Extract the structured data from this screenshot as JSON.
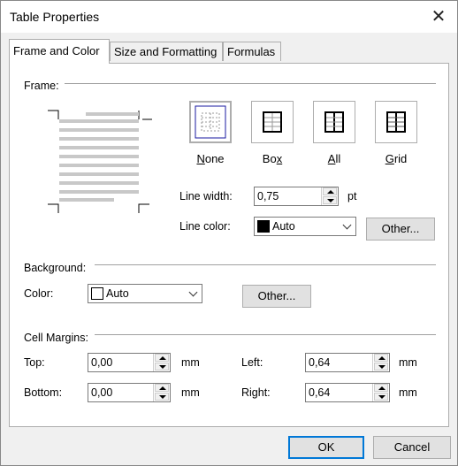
{
  "window": {
    "title": "Table Properties"
  },
  "tabs": [
    "Frame and Color",
    "Size and Formatting",
    "Formulas"
  ],
  "frame": {
    "group_label": "Frame:",
    "options": [
      {
        "label_pre": "",
        "mnemonic": "N",
        "label_post": "one"
      },
      {
        "label_pre": "Bo",
        "mnemonic": "x",
        "label_post": ""
      },
      {
        "label_pre": "",
        "mnemonic": "A",
        "label_post": "ll"
      },
      {
        "label_pre": "",
        "mnemonic": "G",
        "label_post": "rid"
      }
    ],
    "line_width_label": "Line width:",
    "line_width_mnemonic_index": 5,
    "line_width_value": "0,75",
    "line_width_unit": "pt",
    "line_color_label": "Line color:",
    "line_color_value": "Auto",
    "line_color_swatch": "#000000",
    "other_button": "Other..."
  },
  "background": {
    "group_label": "Background:",
    "color_label": "Color:",
    "color_value": "Auto",
    "color_swatch": "#ffffff",
    "other_button": "Other..."
  },
  "margins": {
    "group_label": "Cell Margins:",
    "top_label": "Top:",
    "top_value": "0,00",
    "bottom_label": "Bottom:",
    "bottom_value": "0,00",
    "left_label": "Left:",
    "left_value": "0,64",
    "right_label": "Right:",
    "right_value": "0,64",
    "unit": "mm"
  },
  "footer": {
    "ok": "OK",
    "cancel": "Cancel"
  }
}
